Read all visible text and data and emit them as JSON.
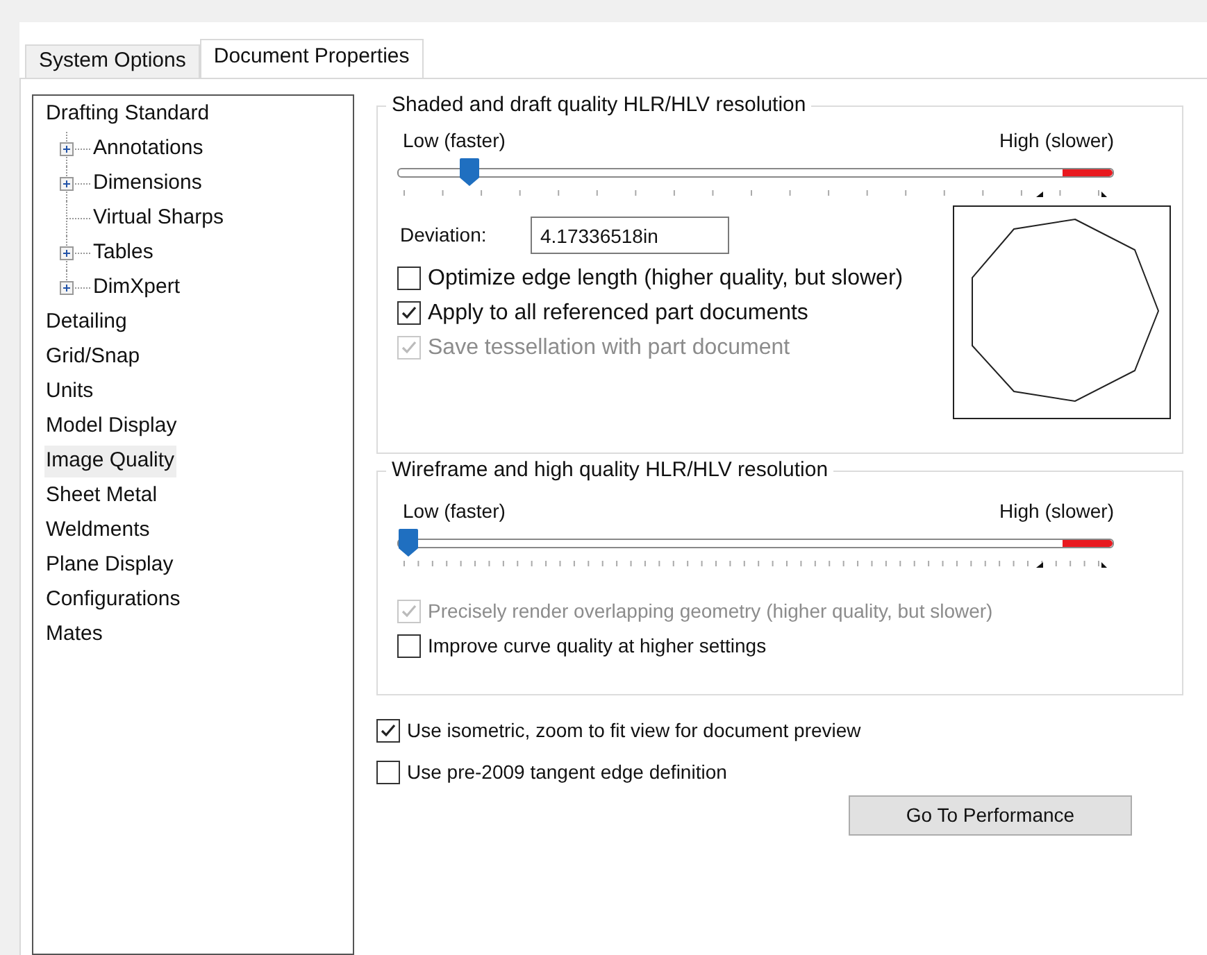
{
  "tabs": [
    {
      "label": "System Options",
      "selected": false
    },
    {
      "label": "Document Properties",
      "selected": true
    }
  ],
  "tree": [
    {
      "label": "Drafting Standard",
      "selected": false,
      "children": [
        {
          "label": "Annotations",
          "kind": "expandable",
          "selected": false
        },
        {
          "label": "Dimensions",
          "kind": "expandable",
          "selected": false
        },
        {
          "label": "Virtual Sharps",
          "kind": "leaf",
          "selected": false
        },
        {
          "label": "Tables",
          "kind": "expandable",
          "selected": false
        },
        {
          "label": "DimXpert",
          "kind": "expandable",
          "selected": false
        }
      ]
    },
    {
      "label": "Detailing",
      "selected": false
    },
    {
      "label": "Grid/Snap",
      "selected": false
    },
    {
      "label": "Units",
      "selected": false
    },
    {
      "label": "Model Display",
      "selected": false
    },
    {
      "label": "Image Quality",
      "selected": true
    },
    {
      "label": "Sheet Metal",
      "selected": false
    },
    {
      "label": "Weldments",
      "selected": false
    },
    {
      "label": "Plane Display",
      "selected": false
    },
    {
      "label": "Configurations",
      "selected": false
    },
    {
      "label": "Mates",
      "selected": false
    }
  ],
  "shaded_group": {
    "title": "Shaded and draft quality HLR/HLV resolution",
    "low_label": "Low (faster)",
    "high_label": "High (slower)",
    "level": 0.088,
    "deviation": {
      "label": "Deviation:",
      "value": "4.17336518in"
    },
    "options": [
      {
        "label": "Optimize edge length (higher quality, but slower)",
        "checked": false,
        "disabled": false
      },
      {
        "label": "Apply to all referenced part documents",
        "checked": true,
        "disabled": false
      },
      {
        "label": "Save tessellation with part document",
        "checked": true,
        "disabled": true
      }
    ]
  },
  "wireframe_group": {
    "title": "Wireframe and high quality HLR/HLV resolution",
    "low_label": "Low (faster)",
    "high_label": "High (slower)",
    "level": 0,
    "options": [
      {
        "label": "Precisely render overlapping geometry (higher quality, but slower)",
        "checked": true,
        "disabled": true
      },
      {
        "label": "Improve curve quality at higher settings",
        "checked": false,
        "disabled": false
      }
    ]
  },
  "options": [
    {
      "label": "Use isometric, zoom to fit view for document preview",
      "checked": true,
      "disabled": false
    },
    {
      "label": "Use pre-2009 tangent edge definition",
      "checked": false,
      "disabled": false
    }
  ],
  "button": "Go To Performance"
}
